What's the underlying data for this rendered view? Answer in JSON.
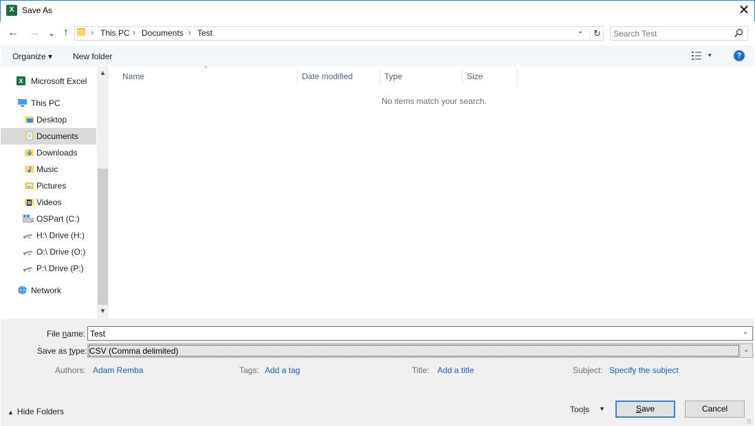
{
  "window": {
    "title": "Save As",
    "app_icon_letter": "X",
    "close_symbol": "✕"
  },
  "nav": {
    "back_symbol": "←",
    "forward_symbol": "→",
    "recent_symbol": "⌄",
    "up_symbol": "↑",
    "breadcrumbs": [
      "This PC",
      "Documents",
      "Test"
    ],
    "crumb_separator": "›",
    "search_placeholder": "Search Test",
    "refresh_symbol": "↻",
    "dropdown_symbol": "⌄"
  },
  "toolbar": {
    "organize_label": "Organize ▾",
    "new_folder_label": "New folder",
    "view_dropdown_symbol": "▾",
    "help_symbol": "?"
  },
  "sidebar": {
    "items": [
      {
        "label": "Microsoft Excel",
        "icon": "excel-icon",
        "selected": false
      },
      {
        "label": "This PC",
        "icon": "pc-icon",
        "selected": false
      },
      {
        "label": "Desktop",
        "icon": "desktop-folder-icon",
        "selected": false
      },
      {
        "label": "Documents",
        "icon": "documents-folder-icon",
        "selected": true
      },
      {
        "label": "Downloads",
        "icon": "downloads-folder-icon",
        "selected": false
      },
      {
        "label": "Music",
        "icon": "music-folder-icon",
        "selected": false
      },
      {
        "label": "Pictures",
        "icon": "pictures-folder-icon",
        "selected": false
      },
      {
        "label": "Videos",
        "icon": "videos-folder-icon",
        "selected": false
      },
      {
        "label": "OSPart (C:)",
        "icon": "system-drive-icon",
        "selected": false
      },
      {
        "label": "H:\\ Drive (H:)",
        "icon": "network-drive-icon",
        "selected": false
      },
      {
        "label": "O:\\ Drive (O:)",
        "icon": "network-drive-icon",
        "selected": false
      },
      {
        "label": "P:\\ Drive (P:)",
        "icon": "network-drive-icon",
        "selected": false
      },
      {
        "label": "Network",
        "icon": "network-icon",
        "selected": false
      }
    ],
    "scroll_up_symbol": "▲",
    "scroll_down_symbol": "▼"
  },
  "filelist": {
    "columns": [
      "Name",
      "Date modified",
      "Type",
      "Size"
    ],
    "sort_symbol": "^",
    "empty_message": "No items match your search."
  },
  "save": {
    "file_name_label_pre": "File ",
    "file_name_label_ul": "n",
    "file_name_label_post": "ame:",
    "file_name_value": "Test",
    "save_type_label_pre": "Save as ",
    "save_type_label_ul": "t",
    "save_type_label_post": "ype:",
    "save_type_value": "CSV (Comma delimited)",
    "dropdown_symbol": "⌄"
  },
  "metadata": {
    "authors_label": "Authors:",
    "authors_value": "Adam Remba",
    "tags_label": "Tags:",
    "tags_value": "Add a tag",
    "title_label": "Title:",
    "title_value": "Add a title",
    "subject_label": "Subject:",
    "subject_value": "Specify the subject"
  },
  "footer": {
    "hide_folders_label": "Hide Folders",
    "hide_folders_symbol": "▲",
    "tools_pre": "Too",
    "tools_ul": "l",
    "tools_post": "s",
    "tools_dropdown_symbol": "▼",
    "save_pre": "",
    "save_ul": "S",
    "save_post": "ave",
    "cancel_label": "Cancel",
    "grip_symbol": "⠿"
  },
  "colors": {
    "accent": "#2b7cd3",
    "link": "#1e5bb3",
    "help": "#1f6fd0",
    "excel": "#1d6f42"
  }
}
